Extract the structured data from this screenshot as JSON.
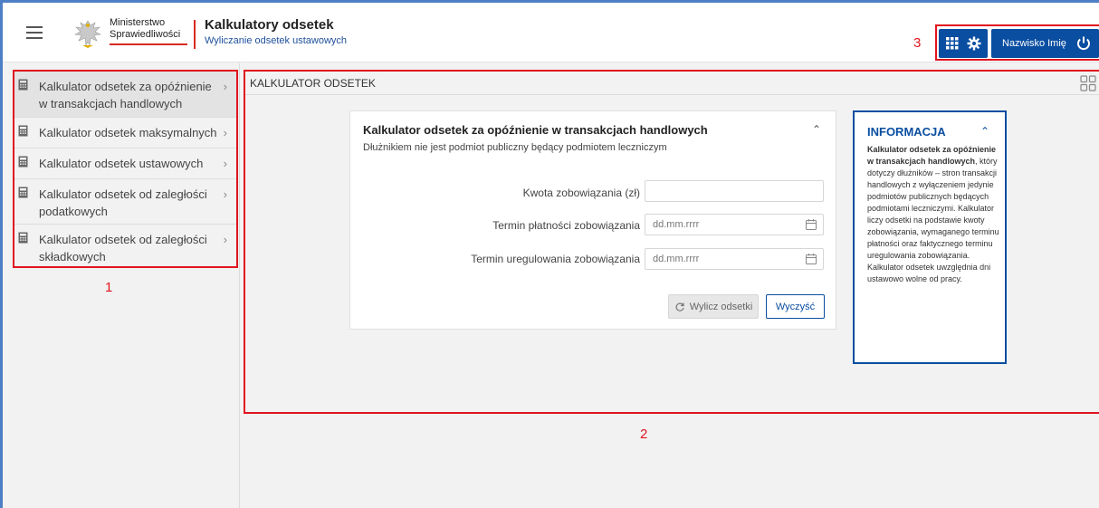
{
  "header": {
    "ministry_line1": "Ministerstwo",
    "ministry_line2": "Sprawiedliwości",
    "app_title": "Kalkulatory odsetek",
    "app_subtitle": "Wyliczanie odsetek ustawowych",
    "user_name": "Nazwisko Imię"
  },
  "annotations": {
    "a1": "1",
    "a2": "2",
    "a3": "3"
  },
  "sidebar": {
    "items": [
      {
        "label": "Kalkulator odsetek za opóźnienie w transakcjach handlowych",
        "active": true
      },
      {
        "label": "Kalkulator odsetek maksymalnych",
        "active": false
      },
      {
        "label": "Kalkulator odsetek ustawowych",
        "active": false
      },
      {
        "label": "Kalkulator odsetek od zaległości podatkowych",
        "active": false
      },
      {
        "label": "Kalkulator odsetek od zaległości składkowych",
        "active": false
      }
    ]
  },
  "main": {
    "section_title": "KALKULATOR ODSETEK",
    "card": {
      "title": "Kalkulator odsetek za opóźnienie w transakcjach handlowych",
      "subtitle": "Dłużnikiem nie jest podmiot publiczny będący podmiotem leczniczym",
      "fields": [
        {
          "label": "Kwota zobowiązania (zł)",
          "value": "",
          "placeholder": ""
        },
        {
          "label": "Termin płatności zobowiązania",
          "value": "",
          "placeholder": "dd.mm.rrrr"
        },
        {
          "label": "Termin uregulowania zobowiązania",
          "value": "",
          "placeholder": "dd.mm.rrrr"
        }
      ],
      "calc_button": "Wylicz odsetki",
      "clear_button": "Wyczyść"
    },
    "info": {
      "title": "INFORMACJA",
      "bold_text": "Kalkulator odsetek za opóźnienie w transakcjach handlowych",
      "text": ", który dotyczy dłużników – stron transakcji handlowych z wyłączeniem jedynie podmiotów publicznych będących podmiotami leczniczymi. Kalkulator liczy odsetki na podstawie kwoty zobowiązania, wymaganego terminu płatności oraz faktycznego terminu uregulowania zobowiązania. Kalkulator odsetek uwzględnia dni ustawowo wolne od pracy."
    }
  },
  "colors": {
    "primary": "#0a4ea1",
    "annotation": "#e0141e",
    "accent_red": "#d52b1e"
  },
  "icons": [
    "menu-icon",
    "eagle-emblem-icon",
    "apps-grid-icon",
    "gear-icon",
    "power-icon",
    "calculator-icon",
    "chevron-right-icon",
    "chevron-up-icon",
    "calendar-icon",
    "refresh-icon",
    "layout-grid-icon"
  ]
}
